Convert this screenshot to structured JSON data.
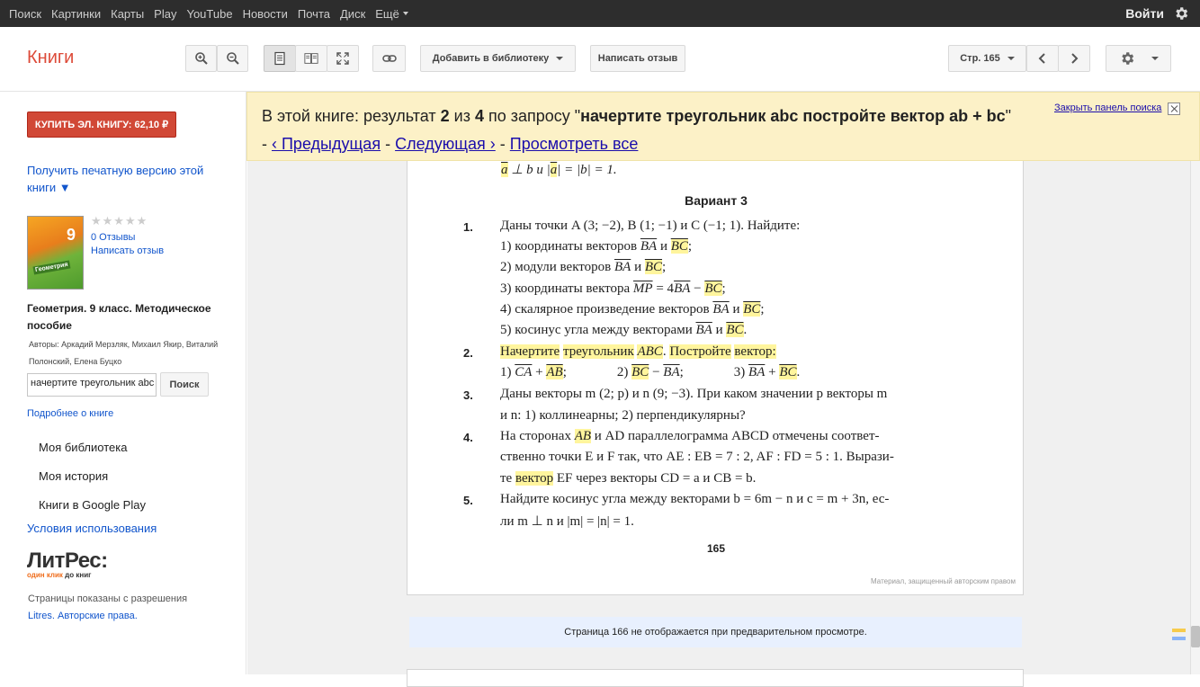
{
  "topbar": {
    "nav": [
      "Поиск",
      "Картинки",
      "Карты",
      "Play",
      "YouTube",
      "Новости",
      "Почта",
      "Диск"
    ],
    "more": "Ещё",
    "login": "Войти"
  },
  "toolbar": {
    "brand": "Книги",
    "add_library": "Добавить в библиотеку",
    "write_review": "Написать отзыв",
    "page_select": "Стр. 165"
  },
  "sidebar": {
    "buy": "КУПИТЬ ЭЛ. КНИГУ: 62,10 ₽",
    "print_version": "Получить печатную версию этой книги ▼",
    "cover_number": "9",
    "cover_label": "Геометрия",
    "stars": "★★★★★",
    "reviews": "0 Отзывы",
    "write_review": "Написать отзыв",
    "title": "Геометрия. 9 класс. Методическое пособие",
    "authors": "Авторы: Аркадий Мерзляк, Михаил Якир, Виталий Полонский, Елена Буцко",
    "search_value": "начертите треугольник abc",
    "search_button": "Поиск",
    "more_about": "Подробнее о книге",
    "items": [
      "Моя библиотека",
      "Моя история",
      "Книги в Google Play"
    ],
    "terms": "Условия использования",
    "litres_logo": "ЛитРес:",
    "litres_tagline_1": "один клик",
    "litres_tagline_2": "до книг",
    "permission_1": "Страницы показаны с разрешения",
    "permission_2": "Litres. Авторские права."
  },
  "search_panel": {
    "prefix": "В этой книге: результат ",
    "current": "2",
    "of": " из ",
    "total": "4",
    "query_prefix": " по запросу \"",
    "query": "начертите треугольник abc постройте вектор ab + bc",
    "query_suffix": "\" - ",
    "prev": "‹ Предыдущая",
    "next": "Следующая ›",
    "dash": " - ",
    "view_all": "Просмотреть все",
    "close": "Закрыть панель поиска"
  },
  "book_page": {
    "top_fragment_a": "a",
    "top_fragment_rest": " ⊥ b  и |",
    "top_fragment_a2": "a",
    "top_fragment_end": "| = |b| = 1.",
    "variant": "Вариант 3",
    "q1_num": "1.",
    "q1_text": "Даны точки A (3; −2), B (1; −1) и C (−1; 1). Найдите:",
    "q1_1": "1) координаты векторов ",
    "q1_1b": "BA",
    "q1_1c": " и ",
    "q1_1d": "BC",
    "q1_1e": ";",
    "q1_2": "2) модули векторов ",
    "q1_2b": "BA",
    "q1_2c": " и ",
    "q1_2d": "BC",
    "q1_2e": ";",
    "q1_3": "3) координаты вектора ",
    "q1_3b": "MP",
    "q1_3c": " = 4",
    "q1_3d": "BA",
    "q1_3e": " − ",
    "q1_3f": "BC",
    "q1_3g": ";",
    "q1_4": "4) скалярное произведение векторов ",
    "q1_4b": "BA",
    "q1_4c": " и ",
    "q1_4d": "BC",
    "q1_4e": ";",
    "q1_5": "5) косинус угла между векторами ",
    "q1_5b": "BA",
    "q1_5c": " и ",
    "q1_5d": "BC",
    "q1_5e": ".",
    "q2_num": "2.",
    "q2_a": "Начертите",
    "q2_b": "треугольник",
    "q2_c": "ABC",
    "q2_d": "Постройте",
    "q2_e": "вектор",
    "q2_f": ":",
    "q2_1": "1) ",
    "q2_1b": "CA",
    "q2_1c": " + ",
    "q2_1d": "AB",
    "q2_1e": ";",
    "q2_2": "2) ",
    "q2_2b": "BC",
    "q2_2c": " − ",
    "q2_2d": "BA",
    "q2_2e": ";",
    "q2_3": "3) ",
    "q2_3b": "BA",
    "q2_3c": " + ",
    "q2_3d": "BC",
    "q2_3e": ".",
    "q3_num": "3.",
    "q3_line1": "Даны векторы m (2; p) и n (9; −3). При каком значении p векторы m",
    "q3_line2": "и n: 1) коллинеарны; 2) перпендикулярны?",
    "q4_num": "4.",
    "q4_line1a": "На сторонах ",
    "q4_line1b": "AB",
    "q4_line1c": " и AD параллелограмма ABCD отмечены соответ-",
    "q4_line2": "ственно точки E и F так, что AE : EB = 7 : 2, AF : FD = 5 : 1. Вырази-",
    "q4_line3a": "те ",
    "q4_line3b": "вектор",
    "q4_line3c": " EF через векторы CD = a и CB = b.",
    "q5_num": "5.",
    "q5_line1": "Найдите косинус угла между векторами b = 6m − n и c = m + 3n, ес-",
    "q5_line2": "ли m ⊥ n и |m| = |n| = 1.",
    "page_number": "165",
    "protected": "Материал, защищенный авторским правом"
  },
  "no_preview": "Страница 166 не отображается при предварительном просмотре."
}
